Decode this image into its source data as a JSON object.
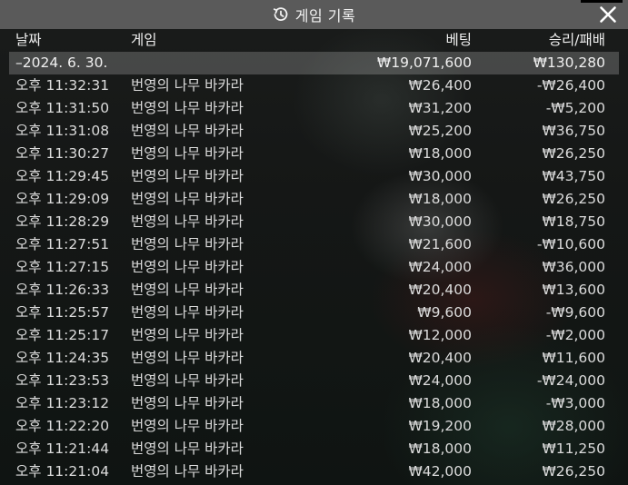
{
  "window": {
    "title": "게임 기록",
    "history_icon": "history-icon",
    "close_icon": "close-icon"
  },
  "table": {
    "headers": {
      "date": "날짜",
      "game": "게임",
      "bet": "베팅",
      "win_loss": "승리/패배"
    },
    "date_group": {
      "label": "–2024. 6. 30.",
      "bet_total": "₩19,071,600",
      "win_loss_total": "₩130,280"
    },
    "rows": [
      {
        "time": "오후 11:32:31",
        "game": "번영의 나무 바카라",
        "bet": "₩26,400",
        "win_loss": "-₩26,400"
      },
      {
        "time": "오후 11:31:50",
        "game": "번영의 나무 바카라",
        "bet": "₩31,200",
        "win_loss": "-₩5,200"
      },
      {
        "time": "오후 11:31:08",
        "game": "번영의 나무 바카라",
        "bet": "₩25,200",
        "win_loss": "₩36,750"
      },
      {
        "time": "오후 11:30:27",
        "game": "번영의 나무 바카라",
        "bet": "₩18,000",
        "win_loss": "₩26,250"
      },
      {
        "time": "오후 11:29:45",
        "game": "번영의 나무 바카라",
        "bet": "₩30,000",
        "win_loss": "₩43,750"
      },
      {
        "time": "오후 11:29:09",
        "game": "번영의 나무 바카라",
        "bet": "₩18,000",
        "win_loss": "₩26,250"
      },
      {
        "time": "오후 11:28:29",
        "game": "번영의 나무 바카라",
        "bet": "₩30,000",
        "win_loss": "₩18,750"
      },
      {
        "time": "오후 11:27:51",
        "game": "번영의 나무 바카라",
        "bet": "₩21,600",
        "win_loss": "-₩10,600"
      },
      {
        "time": "오후 11:27:15",
        "game": "번영의 나무 바카라",
        "bet": "₩24,000",
        "win_loss": "₩36,000"
      },
      {
        "time": "오후 11:26:33",
        "game": "번영의 나무 바카라",
        "bet": "₩20,400",
        "win_loss": "₩13,600"
      },
      {
        "time": "오후 11:25:57",
        "game": "번영의 나무 바카라",
        "bet": "₩9,600",
        "win_loss": "-₩9,600"
      },
      {
        "time": "오후 11:25:17",
        "game": "번영의 나무 바카라",
        "bet": "₩12,000",
        "win_loss": "-₩2,000"
      },
      {
        "time": "오후 11:24:35",
        "game": "번영의 나무 바카라",
        "bet": "₩20,400",
        "win_loss": "₩11,600"
      },
      {
        "time": "오후 11:23:53",
        "game": "번영의 나무 바카라",
        "bet": "₩24,000",
        "win_loss": "-₩24,000"
      },
      {
        "time": "오후 11:23:12",
        "game": "번영의 나무 바카라",
        "bet": "₩18,000",
        "win_loss": "-₩3,000"
      },
      {
        "time": "오후 11:22:20",
        "game": "번영의 나무 바카라",
        "bet": "₩19,200",
        "win_loss": "₩28,000"
      },
      {
        "time": "오후 11:21:44",
        "game": "번영의 나무 바카라",
        "bet": "₩18,000",
        "win_loss": "₩11,250"
      },
      {
        "time": "오후 11:21:04",
        "game": "번영의 나무 바카라",
        "bet": "₩42,000",
        "win_loss": "₩26,250"
      }
    ]
  }
}
